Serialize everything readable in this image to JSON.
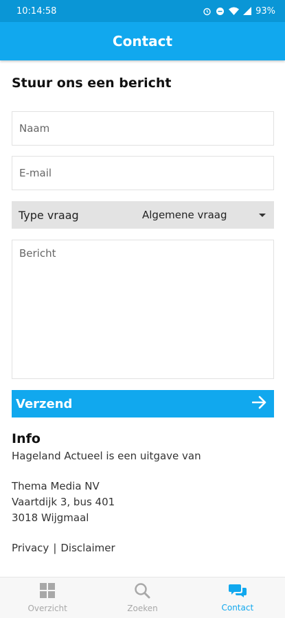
{
  "status_bar": {
    "time": "10:14:58",
    "battery": "93%"
  },
  "app_bar": {
    "title": "Contact"
  },
  "form": {
    "title": "Stuur ons een bericht",
    "name_placeholder": "Naam",
    "email_placeholder": "E-mail",
    "type_label": "Type vraag",
    "type_value": "Algemene vraag",
    "message_placeholder": "Bericht",
    "submit_label": "Verzend"
  },
  "info": {
    "title": "Info",
    "line1": "Hageland Actueel is een uitgave van",
    "company": "Thema Media NV",
    "street": "Vaartdijk 3, bus 401",
    "city": "3018 Wijgmaal",
    "privacy": "Privacy",
    "separator": "|",
    "disclaimer": "Disclaimer"
  },
  "bottom_nav": {
    "items": [
      {
        "label": "Overzicht",
        "icon": "grid-icon",
        "active": false
      },
      {
        "label": "Zoeken",
        "icon": "search-icon",
        "active": false
      },
      {
        "label": "Contact",
        "icon": "chat-icon",
        "active": true
      }
    ]
  },
  "colors": {
    "accent": "#11a8ee",
    "status_bar": "#0a96d6",
    "inactive": "#a8a8a8"
  }
}
